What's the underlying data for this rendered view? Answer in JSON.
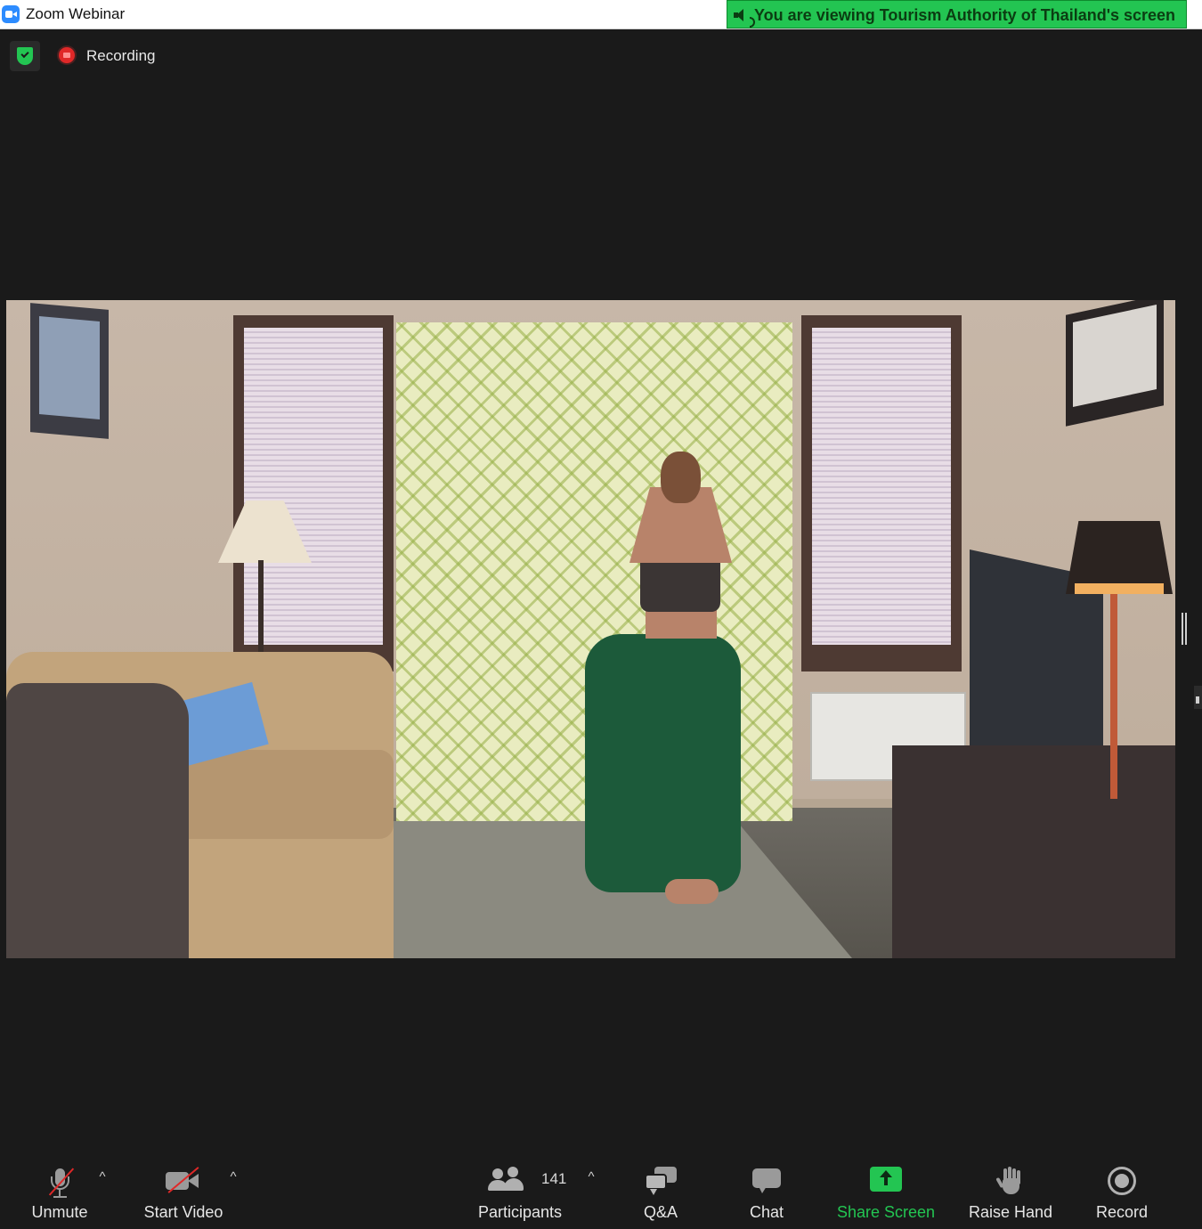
{
  "window": {
    "title": "Zoom Webinar",
    "banner": "You are viewing Tourism Authority of Thailand's screen"
  },
  "status": {
    "recording_label": "Recording"
  },
  "toolbar": {
    "unmute_label": "Unmute",
    "start_video_label": "Start Video",
    "participants_label": "Participants",
    "participants_count": "141",
    "qa_label": "Q&A",
    "chat_label": "Chat",
    "share_screen_label": "Share Screen",
    "raise_hand_label": "Raise Hand",
    "record_label": "Record",
    "caret_glyph": "^"
  },
  "colors": {
    "accent_green": "#23c552",
    "recording_red": "#e02828",
    "background": "#1a1a1a"
  },
  "icons": [
    "zoom-app-icon",
    "speaker-icon",
    "security-shield-icon",
    "recording-icon",
    "microphone-muted-icon",
    "video-camera-off-icon",
    "participants-icon",
    "qa-icon",
    "chat-icon",
    "share-screen-icon",
    "raise-hand-icon",
    "record-icon"
  ]
}
